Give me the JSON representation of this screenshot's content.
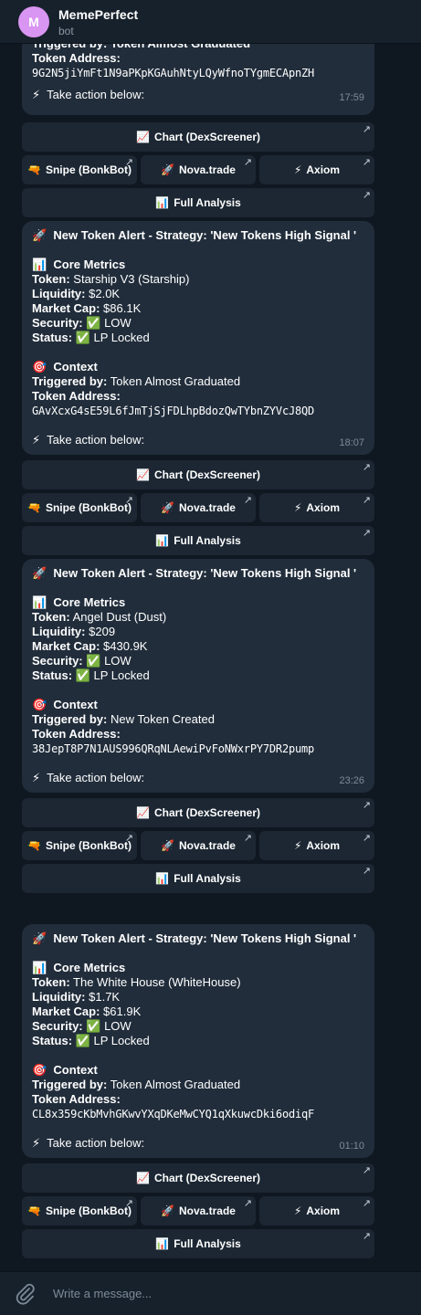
{
  "header": {
    "avatar_letter": "M",
    "title": "MemePerfect",
    "subtitle": "bot"
  },
  "top_fragment": {
    "lines": [
      "Triggered by: Token Almost Graduated",
      "Token Address:"
    ],
    "address": "9G2N5jiYmFt1N9aPKpKGAuhNtyLQyWfnoTYgmECApnZH",
    "action": "Take action below:",
    "time": "17:59"
  },
  "buttons": {
    "chart": "Chart (DexScreener)",
    "snipe": "Snipe (BonkBot)",
    "nova": "Nova.trade",
    "axiom": "Axiom",
    "analysis": "Full Analysis"
  },
  "messages": [
    {
      "title": "New Token Alert - Strategy: 'New Tokens High Signal '",
      "core_heading": "Core Metrics",
      "token_label": "Token:",
      "token": "Starship V3 (Starship)",
      "liquidity_label": "Liquidity:",
      "liquidity": "$2.0K",
      "mcap_label": "Market Cap:",
      "mcap": "$86.1K",
      "security_label": "Security:",
      "security": "LOW",
      "status_label": "Status:",
      "status": "LP Locked",
      "context_heading": "Context",
      "trigger_label": "Triggered by:",
      "trigger": "Token Almost Graduated",
      "address_label": "Token Address:",
      "address": "GAvXcxG4sE59L6fJmTjSjFDLhpBdozQwTYbnZYVcJ8QD",
      "action": "Take action below:",
      "time": "18:07"
    },
    {
      "title": "New Token Alert - Strategy: 'New Tokens High Signal '",
      "core_heading": "Core Metrics",
      "token_label": "Token:",
      "token": "Angel Dust (Dust)",
      "liquidity_label": "Liquidity:",
      "liquidity": "$209",
      "mcap_label": "Market Cap:",
      "mcap": "$430.9K",
      "security_label": "Security:",
      "security": "LOW",
      "status_label": "Status:",
      "status": "LP Locked",
      "context_heading": "Context",
      "trigger_label": "Triggered by:",
      "trigger": "New Token Created",
      "address_label": "Token Address:",
      "address": "38JepT8P7N1AUS996QRqNLAewiPvFoNWxrPY7DR2pump",
      "action": "Take action below:",
      "time": "23:26"
    },
    {
      "title": "New Token Alert - Strategy: 'New Tokens High Signal '",
      "core_heading": "Core Metrics",
      "token_label": "Token:",
      "token": "The White House (WhiteHouse)",
      "liquidity_label": "Liquidity:",
      "liquidity": "$1.7K",
      "mcap_label": "Market Cap:",
      "mcap": "$61.9K",
      "security_label": "Security:",
      "security": "LOW",
      "status_label": "Status:",
      "status": "LP Locked",
      "context_heading": "Context",
      "trigger_label": "Triggered by:",
      "trigger": "Token Almost Graduated",
      "address_label": "Token Address:",
      "address": "CL8x359cKbMvhGKwvYXqDKeMwCYQ1qXkuwcDki6odiqF",
      "action": "Take action below:",
      "time": "01:10"
    }
  ],
  "icons": {
    "rocket": "🚀",
    "chart": "📊",
    "target": "🎯",
    "check": "✅",
    "bolt": "⚡",
    "chart_up": "📈",
    "pistol": "🔫",
    "arrow": "↗"
  },
  "input": {
    "placeholder": "Write a message..."
  },
  "colors": {
    "background": "#0f1721",
    "bubble": "#212d3b",
    "button": "#1c2733",
    "header": "#17212b",
    "avatar": "#d995f2"
  }
}
